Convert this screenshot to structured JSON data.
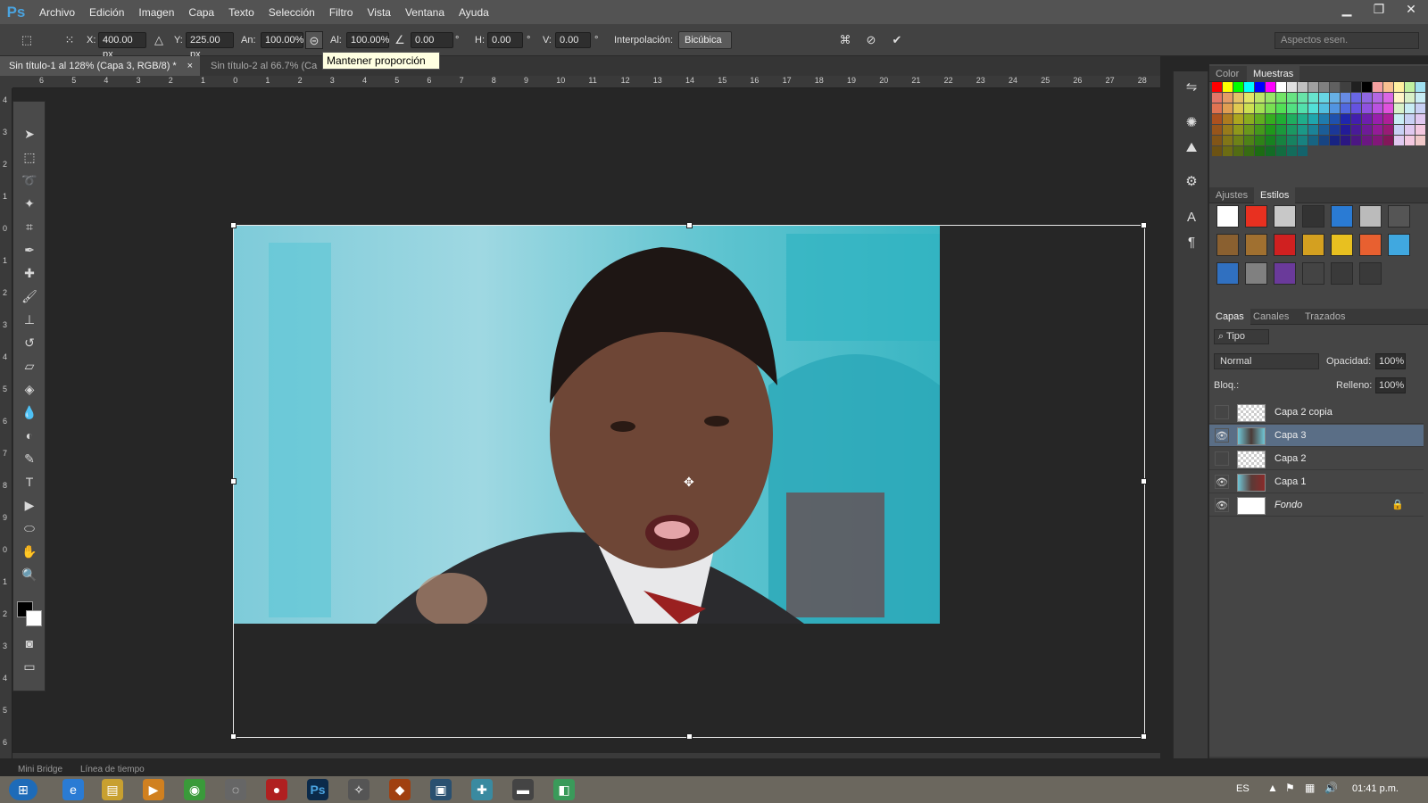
{
  "app": {
    "logo": "Ps"
  },
  "menu": [
    "Archivo",
    "Edición",
    "Imagen",
    "Capa",
    "Texto",
    "Selección",
    "Filtro",
    "Vista",
    "Ventana",
    "Ayuda"
  ],
  "window_controls": [
    "minimize-icon",
    "restore-icon",
    "close-icon"
  ],
  "options": {
    "x_label": "X:",
    "x_value": "400.00 px",
    "y_label": "Y:",
    "y_value": "225.00 px",
    "w_label": "An:",
    "w_value": "100.00%",
    "h_label": "Al:",
    "h_value": "100.00%",
    "angle_value": "0.00",
    "deg1": "°",
    "hskew_label": "H:",
    "hskew_value": "0.00",
    "deg2": "°",
    "vskew_label": "V:",
    "vskew_value": "0.00",
    "deg3": "°",
    "interp_label": "Interpolación:",
    "interp_value": "Bicúbica",
    "workspace": "Aspectos esen."
  },
  "tooltip": "Mantener proporción",
  "tabs": [
    {
      "label": "Sin título-1 al 128% (Capa 3, RGB/8) *",
      "close": "×"
    },
    {
      "label": "Sin título-2 al 66.7% (Ca"
    }
  ],
  "ruler_top": [
    "6",
    "5",
    "4",
    "3",
    "2",
    "1",
    "0",
    "1",
    "2",
    "3",
    "4",
    "5",
    "6",
    "7",
    "8",
    "9",
    "10",
    "11",
    "12",
    "13",
    "14",
    "15",
    "16",
    "17",
    "18",
    "19",
    "20",
    "21",
    "22",
    "23",
    "24",
    "25",
    "26",
    "27",
    "28"
  ],
  "ruler_left": [
    "4",
    "3",
    "2",
    "1",
    "0",
    "1",
    "2",
    "3",
    "4",
    "5",
    "6",
    "7",
    "8",
    "9",
    "0",
    "1",
    "2",
    "3",
    "4",
    "5",
    "6"
  ],
  "panels": {
    "color_tabs": [
      "Color",
      "Muestras"
    ],
    "style_tabs": [
      "Ajustes",
      "Estilos"
    ],
    "layer_tabs": [
      "Capas",
      "Canales",
      "Trazados"
    ],
    "filter_kind": "Tipo",
    "blend_mode": "Normal",
    "opacity_label": "Opacidad:",
    "opacity_value": "100%",
    "lock_label": "Bloq.:",
    "fill_label": "Relleno:",
    "fill_value": "100%"
  },
  "layers": [
    {
      "name": "Capa 2 copia",
      "visible": false,
      "selected": false
    },
    {
      "name": "Capa 3",
      "visible": true,
      "selected": true
    },
    {
      "name": "Capa 2",
      "visible": false,
      "selected": false
    },
    {
      "name": "Capa 1",
      "visible": true,
      "selected": false
    },
    {
      "name": "Fondo",
      "visible": true,
      "selected": false,
      "locked": true
    }
  ],
  "bottom_tabs": [
    "Mini Bridge",
    "Línea de tiempo"
  ],
  "taskbar": {
    "lang": "ES",
    "time": "01:41 p.m."
  },
  "colors": {
    "accent": "#4aa3df",
    "selected_layer": "#5a6e86",
    "tooltip_bg": "#ffffe1"
  }
}
